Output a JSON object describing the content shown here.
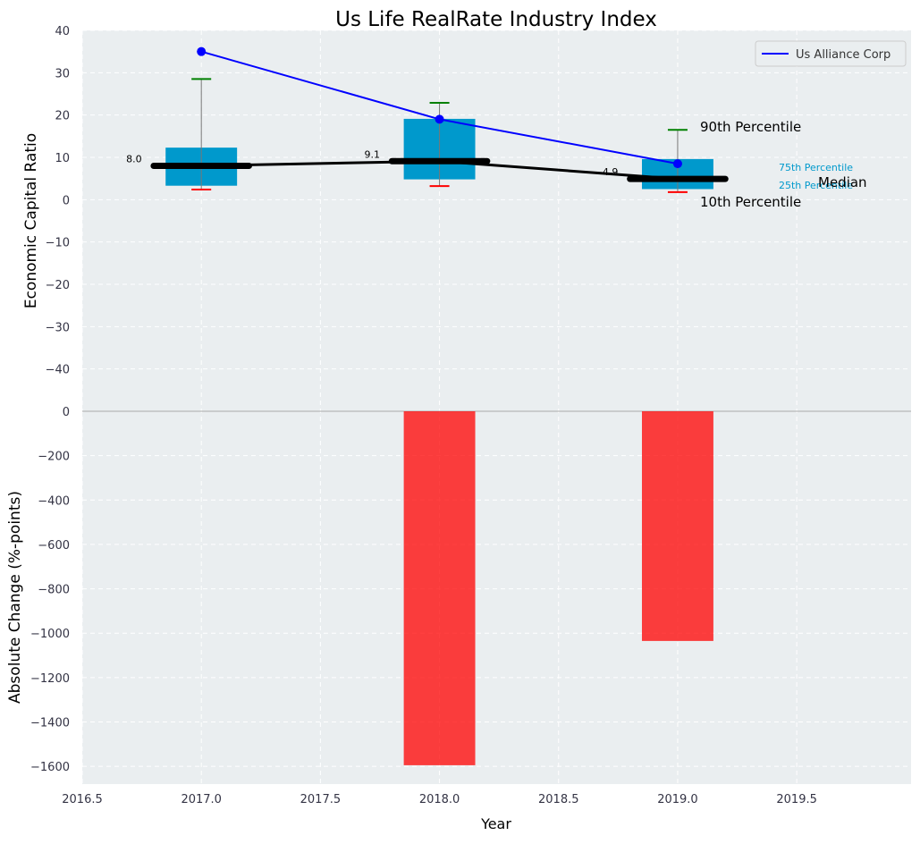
{
  "chart_data": [
    {
      "type": "box",
      "title": "Us Life RealRate Industry Index",
      "ylabel": "Economic Capital Ratio",
      "ylim": [
        -50,
        40
      ],
      "yticks": [
        40,
        30,
        20,
        10,
        0,
        -10,
        -20,
        -30,
        -40
      ],
      "x": [
        2017,
        2018,
        2019
      ],
      "p10": [
        2.4,
        3.2,
        1.8
      ],
      "q25": [
        3.3,
        4.8,
        2.5
      ],
      "median": [
        8.0,
        9.1,
        4.9
      ],
      "q75": [
        12.3,
        19.1,
        9.6
      ],
      "p90": [
        28.5,
        22.9,
        16.5
      ],
      "median_labels": [
        "8.0",
        "9.1",
        "4.9"
      ],
      "series": [
        {
          "name": "Us Alliance Corp",
          "values": [
            35,
            19,
            8.5
          ],
          "color": "#0000ff"
        }
      ],
      "legend": "top-right",
      "annotations": {
        "p90": "90th Percentile",
        "p10": "10th Percentile",
        "q75": "75th Percentile",
        "q25": "25th Percentile",
        "median": "Median"
      },
      "grid": true
    },
    {
      "type": "bar",
      "xlabel": "Year",
      "ylabel": "Absolute Change (%-points)",
      "ylim": [
        -1680,
        0
      ],
      "yticks": [
        0,
        -200,
        -400,
        -600,
        -800,
        -1000,
        -1200,
        -1400,
        -1600
      ],
      "xlim": [
        2016.5,
        2019.98
      ],
      "xticks": [
        2016.5,
        2017.0,
        2017.5,
        2018.0,
        2018.5,
        2019.0,
        2019.5
      ],
      "xtick_labels": [
        "2016.5",
        "2017.0",
        "2017.5",
        "2018.0",
        "2018.5",
        "2019.0",
        "2019.5"
      ],
      "x": [
        2018,
        2019
      ],
      "values": [
        -1595,
        -1035
      ],
      "color": "#ff0000",
      "grid": true
    }
  ],
  "colors": {
    "box": "#0099cc",
    "bg": "#eaeef0"
  }
}
